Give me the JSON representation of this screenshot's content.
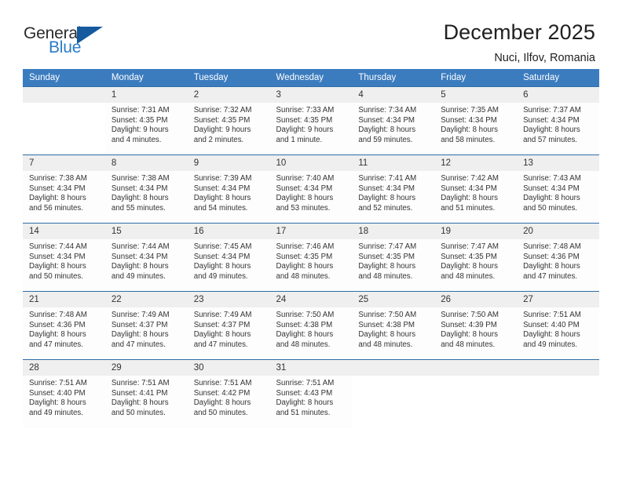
{
  "brand": {
    "name_part1": "General",
    "name_part2": "Blue",
    "triangle_color": "#15599e",
    "blue_text_color": "#2a7cc4"
  },
  "header": {
    "title": "December 2025",
    "location": "Nuci, Ilfov, Romania",
    "header_bg": "#3b7cbf",
    "row_border": "#2e6da8",
    "daynum_bg": "#efefef"
  },
  "weekdays": [
    "Sunday",
    "Monday",
    "Tuesday",
    "Wednesday",
    "Thursday",
    "Friday",
    "Saturday"
  ],
  "weeks": [
    [
      {
        "empty": true
      },
      {
        "day": "1",
        "sunrise": "Sunrise: 7:31 AM",
        "sunset": "Sunset: 4:35 PM",
        "daylight1": "Daylight: 9 hours",
        "daylight2": "and 4 minutes."
      },
      {
        "day": "2",
        "sunrise": "Sunrise: 7:32 AM",
        "sunset": "Sunset: 4:35 PM",
        "daylight1": "Daylight: 9 hours",
        "daylight2": "and 2 minutes."
      },
      {
        "day": "3",
        "sunrise": "Sunrise: 7:33 AM",
        "sunset": "Sunset: 4:35 PM",
        "daylight1": "Daylight: 9 hours",
        "daylight2": "and 1 minute."
      },
      {
        "day": "4",
        "sunrise": "Sunrise: 7:34 AM",
        "sunset": "Sunset: 4:34 PM",
        "daylight1": "Daylight: 8 hours",
        "daylight2": "and 59 minutes."
      },
      {
        "day": "5",
        "sunrise": "Sunrise: 7:35 AM",
        "sunset": "Sunset: 4:34 PM",
        "daylight1": "Daylight: 8 hours",
        "daylight2": "and 58 minutes."
      },
      {
        "day": "6",
        "sunrise": "Sunrise: 7:37 AM",
        "sunset": "Sunset: 4:34 PM",
        "daylight1": "Daylight: 8 hours",
        "daylight2": "and 57 minutes."
      }
    ],
    [
      {
        "day": "7",
        "sunrise": "Sunrise: 7:38 AM",
        "sunset": "Sunset: 4:34 PM",
        "daylight1": "Daylight: 8 hours",
        "daylight2": "and 56 minutes."
      },
      {
        "day": "8",
        "sunrise": "Sunrise: 7:38 AM",
        "sunset": "Sunset: 4:34 PM",
        "daylight1": "Daylight: 8 hours",
        "daylight2": "and 55 minutes."
      },
      {
        "day": "9",
        "sunrise": "Sunrise: 7:39 AM",
        "sunset": "Sunset: 4:34 PM",
        "daylight1": "Daylight: 8 hours",
        "daylight2": "and 54 minutes."
      },
      {
        "day": "10",
        "sunrise": "Sunrise: 7:40 AM",
        "sunset": "Sunset: 4:34 PM",
        "daylight1": "Daylight: 8 hours",
        "daylight2": "and 53 minutes."
      },
      {
        "day": "11",
        "sunrise": "Sunrise: 7:41 AM",
        "sunset": "Sunset: 4:34 PM",
        "daylight1": "Daylight: 8 hours",
        "daylight2": "and 52 minutes."
      },
      {
        "day": "12",
        "sunrise": "Sunrise: 7:42 AM",
        "sunset": "Sunset: 4:34 PM",
        "daylight1": "Daylight: 8 hours",
        "daylight2": "and 51 minutes."
      },
      {
        "day": "13",
        "sunrise": "Sunrise: 7:43 AM",
        "sunset": "Sunset: 4:34 PM",
        "daylight1": "Daylight: 8 hours",
        "daylight2": "and 50 minutes."
      }
    ],
    [
      {
        "day": "14",
        "sunrise": "Sunrise: 7:44 AM",
        "sunset": "Sunset: 4:34 PM",
        "daylight1": "Daylight: 8 hours",
        "daylight2": "and 50 minutes."
      },
      {
        "day": "15",
        "sunrise": "Sunrise: 7:44 AM",
        "sunset": "Sunset: 4:34 PM",
        "daylight1": "Daylight: 8 hours",
        "daylight2": "and 49 minutes."
      },
      {
        "day": "16",
        "sunrise": "Sunrise: 7:45 AM",
        "sunset": "Sunset: 4:34 PM",
        "daylight1": "Daylight: 8 hours",
        "daylight2": "and 49 minutes."
      },
      {
        "day": "17",
        "sunrise": "Sunrise: 7:46 AM",
        "sunset": "Sunset: 4:35 PM",
        "daylight1": "Daylight: 8 hours",
        "daylight2": "and 48 minutes."
      },
      {
        "day": "18",
        "sunrise": "Sunrise: 7:47 AM",
        "sunset": "Sunset: 4:35 PM",
        "daylight1": "Daylight: 8 hours",
        "daylight2": "and 48 minutes."
      },
      {
        "day": "19",
        "sunrise": "Sunrise: 7:47 AM",
        "sunset": "Sunset: 4:35 PM",
        "daylight1": "Daylight: 8 hours",
        "daylight2": "and 48 minutes."
      },
      {
        "day": "20",
        "sunrise": "Sunrise: 7:48 AM",
        "sunset": "Sunset: 4:36 PM",
        "daylight1": "Daylight: 8 hours",
        "daylight2": "and 47 minutes."
      }
    ],
    [
      {
        "day": "21",
        "sunrise": "Sunrise: 7:48 AM",
        "sunset": "Sunset: 4:36 PM",
        "daylight1": "Daylight: 8 hours",
        "daylight2": "and 47 minutes."
      },
      {
        "day": "22",
        "sunrise": "Sunrise: 7:49 AM",
        "sunset": "Sunset: 4:37 PM",
        "daylight1": "Daylight: 8 hours",
        "daylight2": "and 47 minutes."
      },
      {
        "day": "23",
        "sunrise": "Sunrise: 7:49 AM",
        "sunset": "Sunset: 4:37 PM",
        "daylight1": "Daylight: 8 hours",
        "daylight2": "and 47 minutes."
      },
      {
        "day": "24",
        "sunrise": "Sunrise: 7:50 AM",
        "sunset": "Sunset: 4:38 PM",
        "daylight1": "Daylight: 8 hours",
        "daylight2": "and 48 minutes."
      },
      {
        "day": "25",
        "sunrise": "Sunrise: 7:50 AM",
        "sunset": "Sunset: 4:38 PM",
        "daylight1": "Daylight: 8 hours",
        "daylight2": "and 48 minutes."
      },
      {
        "day": "26",
        "sunrise": "Sunrise: 7:50 AM",
        "sunset": "Sunset: 4:39 PM",
        "daylight1": "Daylight: 8 hours",
        "daylight2": "and 48 minutes."
      },
      {
        "day": "27",
        "sunrise": "Sunrise: 7:51 AM",
        "sunset": "Sunset: 4:40 PM",
        "daylight1": "Daylight: 8 hours",
        "daylight2": "and 49 minutes."
      }
    ],
    [
      {
        "day": "28",
        "sunrise": "Sunrise: 7:51 AM",
        "sunset": "Sunset: 4:40 PM",
        "daylight1": "Daylight: 8 hours",
        "daylight2": "and 49 minutes."
      },
      {
        "day": "29",
        "sunrise": "Sunrise: 7:51 AM",
        "sunset": "Sunset: 4:41 PM",
        "daylight1": "Daylight: 8 hours",
        "daylight2": "and 50 minutes."
      },
      {
        "day": "30",
        "sunrise": "Sunrise: 7:51 AM",
        "sunset": "Sunset: 4:42 PM",
        "daylight1": "Daylight: 8 hours",
        "daylight2": "and 50 minutes."
      },
      {
        "day": "31",
        "sunrise": "Sunrise: 7:51 AM",
        "sunset": "Sunset: 4:43 PM",
        "daylight1": "Daylight: 8 hours",
        "daylight2": "and 51 minutes."
      },
      {
        "empty": true
      },
      {
        "empty": true
      },
      {
        "empty": true
      }
    ]
  ]
}
